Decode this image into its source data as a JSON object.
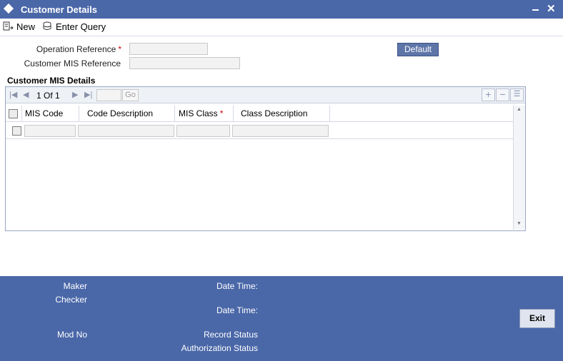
{
  "window": {
    "title": "Customer Details"
  },
  "toolbar": {
    "new_label": "New",
    "enter_query_label": "Enter Query"
  },
  "form": {
    "operation_reference_label": "Operation Reference",
    "customer_mis_reference_label": "Customer MIS Reference",
    "required_mark": "*",
    "default_button": "Default"
  },
  "mis_details": {
    "section_title": "Customer MIS Details",
    "pagination": {
      "text": "1 Of 1",
      "go": "Go"
    },
    "columns": [
      "MIS Code",
      "Code Description",
      "MIS Class",
      "Class Description"
    ]
  },
  "footer": {
    "maker": "Maker",
    "checker": "Checker",
    "date_time_1": "Date Time:",
    "date_time_2": "Date Time:",
    "mod_no": "Mod No",
    "record_status": "Record Status",
    "authorization_status": "Authorization Status",
    "exit": "Exit"
  },
  "colors": {
    "titlebar": "#4a67a8",
    "footer": "#4a67a8",
    "required": "#cc0000",
    "default_button": "#5e75a8"
  }
}
